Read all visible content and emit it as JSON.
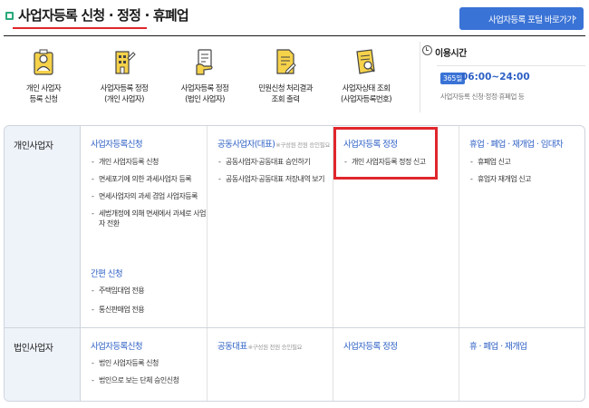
{
  "header": {
    "title": "사업자등록 신청 · 정정 · 휴폐업",
    "portal_button": "사업자등록 포털 바로가기",
    "portal_chevron": "›"
  },
  "services": [
    {
      "line1": "개인 사업자",
      "line2": "등록 신청",
      "icon": "person-doc-icon"
    },
    {
      "line1": "사업자등록 정정",
      "line2": "(개인 사업자)",
      "icon": "building-edit-icon"
    },
    {
      "line1": "사업자등록 정정",
      "line2": "(법인 사업자)",
      "icon": "hand-doc-icon"
    },
    {
      "line1": "민원신청 처리결과",
      "line2": "조회 출력",
      "icon": "doc-edit-icon"
    },
    {
      "line1": "사업자상태 조회",
      "line2": "(사업자등록번호)",
      "icon": "search-doc-icon"
    }
  ],
  "hours": {
    "label": "이용시간",
    "badge": "365일",
    "time": "06:00~24:00",
    "note": "사업자등록 신청·정정·휴폐업 등"
  },
  "rows": [
    {
      "label": "개인사업자",
      "cols": [
        {
          "title": "사업자등록신청",
          "note": "",
          "items": [
            "개인 사업자등록 신청",
            "면세포기에 의한 과세사업자 등록",
            "면세사업자의 과세 겸업 사업자등록",
            "세법개정에 의해 면세에서 과세로 사업자 전환"
          ],
          "sub_title": "간편 신청",
          "sub_items": [
            "주택임대업 전용",
            "통신판매업 전용"
          ]
        },
        {
          "title": "공동사업자(대표)",
          "note": "※구성원 전원 승인필요",
          "items": [
            "공동사업자·공동대표 승인하기",
            "공동사업자·공동대표 저장내역 보기"
          ]
        },
        {
          "title": "사업자등록 정정",
          "note": "",
          "items": [
            "개인 사업자등록 정정 신고"
          ]
        },
        {
          "title": "휴업 · 폐업 · 재개업 · 임대차",
          "note": "",
          "items": [
            "휴폐업 신고",
            "휴업자 재개업 신고"
          ]
        }
      ]
    },
    {
      "label": "법인사업자",
      "cols": [
        {
          "title": "사업자등록신청",
          "note": "",
          "items": [
            "법인 사업자등록 신청",
            "법인으로 보는 단체 승인신청"
          ]
        },
        {
          "title": "공동대표",
          "note": "※구성원 전원 승인필요",
          "items": []
        },
        {
          "title": "사업자등록 정정",
          "note": "",
          "items": []
        },
        {
          "title": "휴 · 폐업 · 재개업",
          "note": "",
          "items": []
        }
      ]
    }
  ],
  "colors": {
    "accent_blue": "#3a73d6",
    "link_blue": "#2c5fc4",
    "highlight_red": "#e0262c",
    "rowhead_bg": "#eef2f9"
  }
}
